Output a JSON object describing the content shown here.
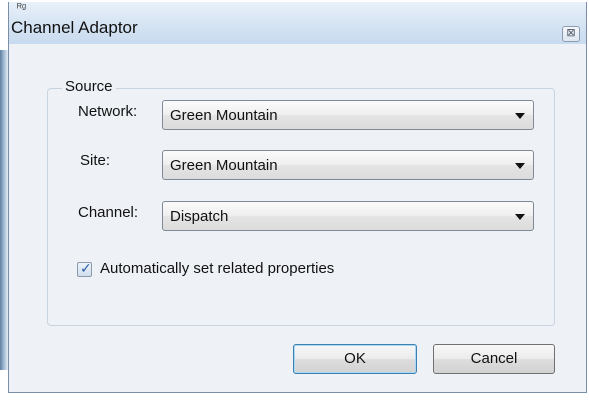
{
  "window": {
    "title": "Channel Adaptor",
    "titlebar_glyph": "ᴿᵍ",
    "close_glyph": "⊠"
  },
  "source_group": {
    "title": "Source",
    "network": {
      "label": "Network:",
      "value": "Green Mountain"
    },
    "site": {
      "label": "Site:",
      "value": "Green Mountain"
    },
    "channel": {
      "label": "Channel:",
      "value": "Dispatch"
    },
    "auto_set": {
      "label": "Automatically set related properties",
      "checked": true,
      "check_glyph": "✓"
    }
  },
  "buttons": {
    "ok": "OK",
    "cancel": "Cancel"
  },
  "icons": {
    "close": "close-icon",
    "dropdown": "chevron-down-icon",
    "check": "check-icon"
  },
  "colors": {
    "titlebar": "#d6e4f3",
    "dialog_background": "#eef2f7",
    "default_button_border": "#3c7fb1"
  }
}
